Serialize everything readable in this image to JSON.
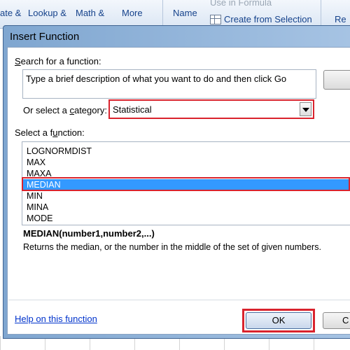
{
  "ribbon": {
    "left_partial_top": "ate &",
    "lookup_top": "Lookup &",
    "math_top": "Math &",
    "more_top": "More",
    "name_manager": "Name",
    "use_in_formula": "Use in Formula",
    "create_from_selection": "Create from Selection",
    "right_partial": "Re"
  },
  "dialog": {
    "title": "Insert Function",
    "search_label": "Search for a function:",
    "search_value": "Type a brief description of what you want to do and then click Go",
    "category_label_pre": "Or select a ",
    "category_label_key": "c",
    "category_label_post": "ategory:",
    "category_value": "Statistical",
    "function_label_pre": "Select a f",
    "function_label_key": "u",
    "function_label_post": "nction:",
    "functions": [
      "LOGNORMDIST",
      "MAX",
      "MAXA",
      "MEDIAN",
      "MIN",
      "MINA",
      "MODE"
    ],
    "selected_function": "MEDIAN",
    "syntax": "MEDIAN(number1,number2,...)",
    "description": "Returns the median, or the number in the middle of the set of given numbers.",
    "help_link": "Help on this function",
    "ok_label": "OK",
    "cancel_label": "C"
  }
}
